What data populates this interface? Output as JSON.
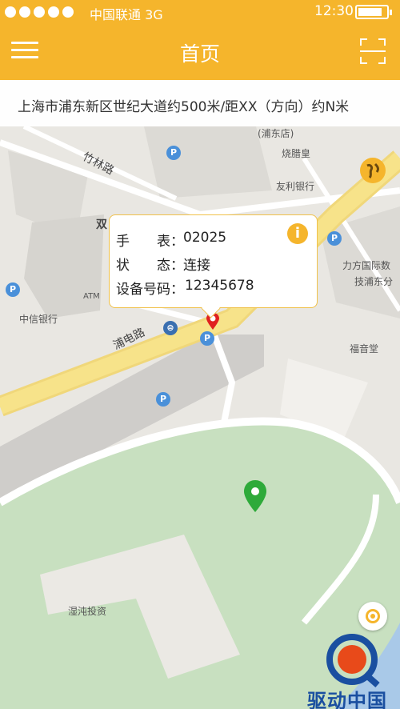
{
  "status_bar": {
    "carrier": "中国联通 3G",
    "time": "12:30",
    "battery_level": 0.85
  },
  "header": {
    "title": "首页",
    "menu_icon": "hamburger-icon",
    "scan_icon": "scan-icon"
  },
  "address": {
    "text": "上海市浦东新区世纪大道约500米/距XX（方向）约N米"
  },
  "popup": {
    "rows": [
      {
        "label": "手　　表：",
        "value": "02025"
      },
      {
        "label": "状　　态：",
        "value": "连接"
      },
      {
        "label": "设备号码：",
        "value": "12345678"
      }
    ],
    "info_icon": "info-icon"
  },
  "map": {
    "roads": [
      "竹林路",
      "浦电路",
      "双"
    ],
    "pois": [
      "烧腊皇",
      "友利银行",
      "中信银行",
      "福音堂",
      "湿沌投资",
      "力方国际数",
      "技浦东分",
      "(浦东店)"
    ],
    "parking_label": "P",
    "atm_label": "ATM"
  },
  "watermark": {
    "text": "驱动中国"
  },
  "colors": {
    "accent": "#f5b52c",
    "park": "#c8e0c0",
    "road_main": "#f7e38a",
    "map_bg": "#e9e7e2",
    "pin_green": "#2eaa3a",
    "pin_red": "#e02020"
  }
}
